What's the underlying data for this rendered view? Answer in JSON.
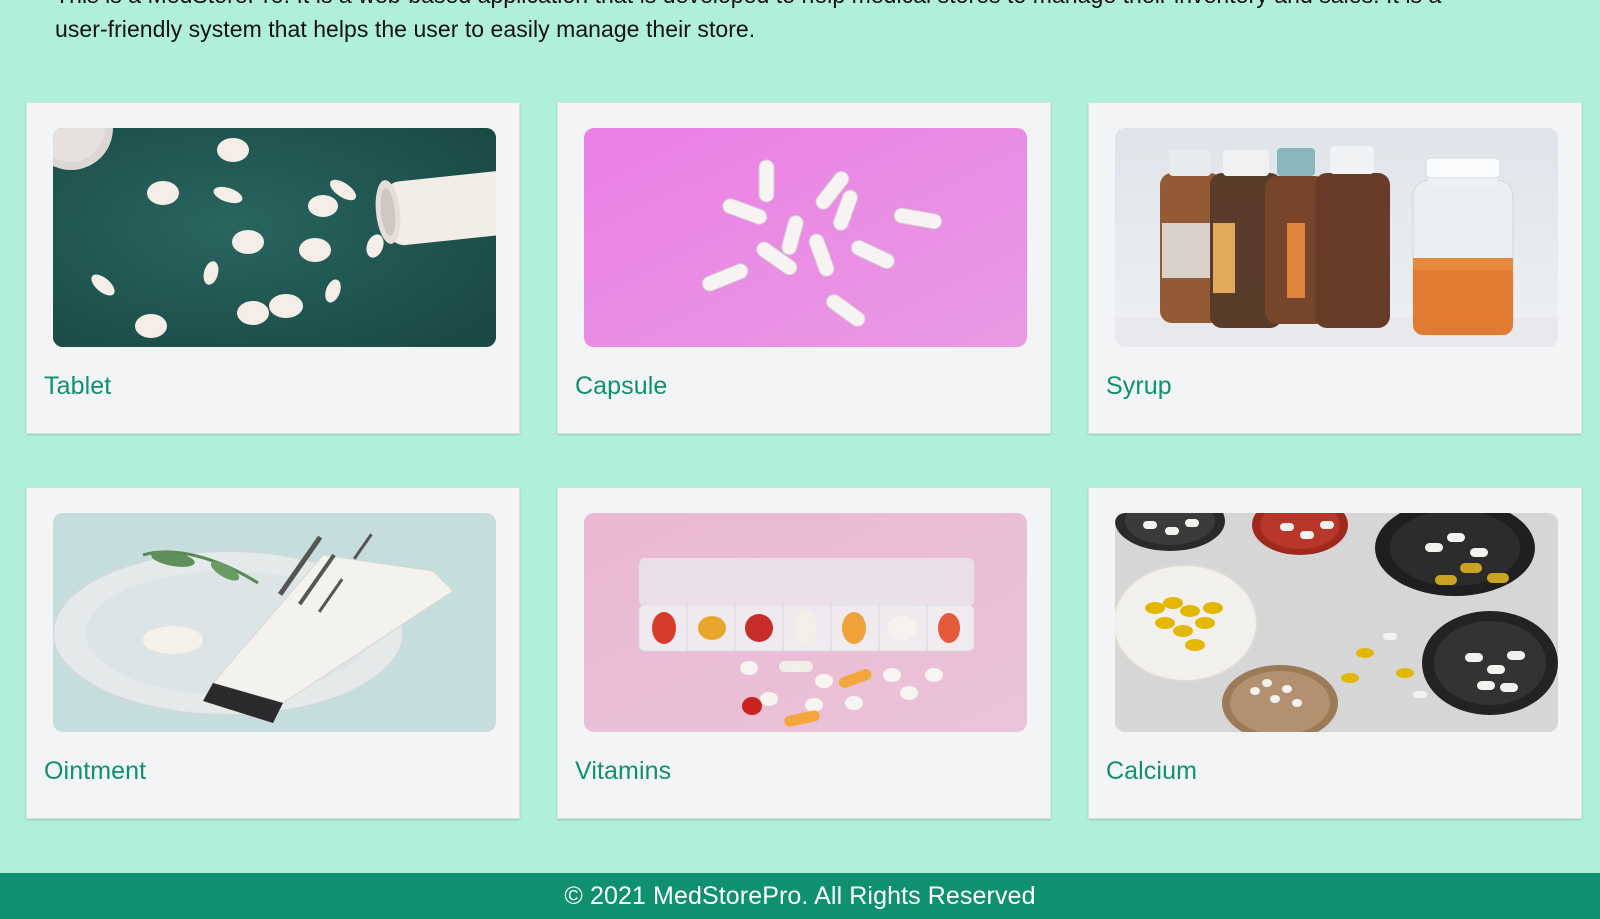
{
  "intro": {
    "line1": "This is a MedStorePro. It is a web-based application that is developed to help medical stores to manage their inventory and sales. It is a",
    "line2": "user-friendly system that helps the user to easily manage their store."
  },
  "categories": [
    {
      "title": "Tablet"
    },
    {
      "title": "Capsule"
    },
    {
      "title": "Syrup"
    },
    {
      "title": "Ointment"
    },
    {
      "title": "Vitamins"
    },
    {
      "title": "Calcium"
    }
  ],
  "footer": {
    "text": "© 2021 MedStorePro. All Rights Reserved"
  },
  "colors": {
    "page_background": "#b0f0d8",
    "card_background": "#f2f4f5",
    "accent": "#0f9071",
    "footer_text": "#ffffff"
  },
  "images": [
    "tablets-spilled-from-bottle-photo",
    "white-capsules-on-pink-photo",
    "syrup-bottles-photo",
    "ointment-tube-on-plate-photo",
    "pill-organizer-photo",
    "calcium-supplements-photo"
  ]
}
